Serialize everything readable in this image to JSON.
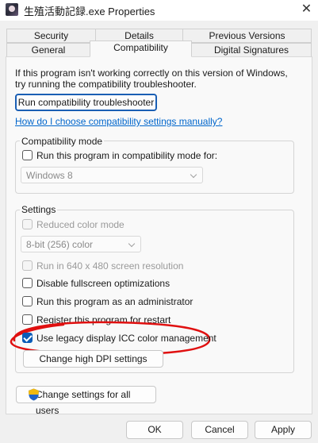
{
  "window": {
    "title": "生殖活動記録.exe Properties",
    "app_icon": "app-icon",
    "close_glyph": "✕"
  },
  "tabs": {
    "row_back": [
      "Security",
      "Details",
      "Previous Versions"
    ],
    "row_front": [
      "General",
      "Compatibility",
      "Digital Signatures"
    ],
    "active": "Compatibility"
  },
  "intro_text": "If this program isn't working correctly on this version of Windows, try running the compatibility troubleshooter.",
  "troubleshooter_button": "Run compatibility troubleshooter",
  "help_link": "How do I choose compatibility settings manually?",
  "compat_mode": {
    "title": "Compatibility mode",
    "checkbox_label": "Run this program in compatibility mode for:",
    "checked": false,
    "os_select": "Windows 8"
  },
  "settings": {
    "title": "Settings",
    "reduced_color": {
      "label": "Reduced color mode",
      "checked": false,
      "disabled": true
    },
    "color_select": "8-bit (256) color",
    "run_640": {
      "label": "Run in 640 x 480 screen resolution",
      "checked": false,
      "disabled": true
    },
    "disable_fullscreen": {
      "label": "Disable fullscreen optimizations",
      "checked": false
    },
    "run_admin": {
      "label": "Run this program as an administrator",
      "checked": false
    },
    "register_restart": {
      "label": "Register this program for restart",
      "checked": false
    },
    "legacy_icc": {
      "label": "Use legacy display ICC color management",
      "checked": true
    },
    "high_dpi_button": "Change high DPI settings"
  },
  "all_users_button": "Change settings for all users",
  "footer": {
    "ok": "OK",
    "cancel": "Cancel",
    "apply": "Apply"
  },
  "colors": {
    "accent": "#0a5cb8",
    "link": "#0066cc",
    "annotation": "#e01010",
    "focus_border": "#1a5fb4"
  },
  "icons": {
    "checkmark": "checkmark-icon",
    "chevron": "chevron-down-icon",
    "shield": "uac-shield-icon"
  }
}
